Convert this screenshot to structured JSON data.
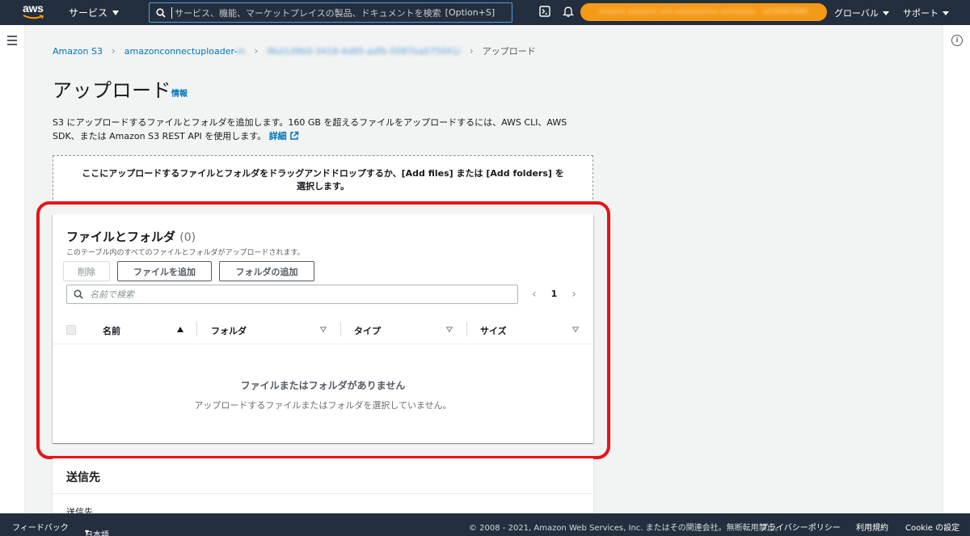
{
  "topnav": {
    "logo_text": "aws",
    "services_label": "サービス",
    "search_placeholder": "サービス、機能、マーケットプレイスの製品、ドキュメントを検索",
    "search_shortcut": "[Option+S]",
    "account_blurred": "xxxxxx xxxxxxx xxx xxxxxxxxxx xxxxxxxx · 1234567890",
    "region_label": "グローバル",
    "support_label": "サポート"
  },
  "breadcrumb": {
    "items": [
      "Amazon S3",
      "amazonconnectuploader-",
      "9bd1d9b0-3418-4d85-adfb-5087ba075041/",
      "アップロード"
    ],
    "bucket_suffix_blurred": "in"
  },
  "page": {
    "title": "アップロード",
    "info_link": "情報",
    "description": "S3 にアップロードするファイルとフォルダを追加します。160 GB を超えるファイルをアップロードするには、AWS CLI、AWS SDK、または Amazon S3 REST API を使用します。",
    "learn_more": "詳細"
  },
  "dropzone": {
    "text": "ここにアップロードするファイルとフォルダをドラッグアンドドロップするか、[Add files] または [Add folders] を選択します。"
  },
  "files_panel": {
    "title": "ファイルとフォルダ",
    "count": "(0)",
    "subtitle": "このテーブル内のすべてのファイルとフォルダがアップロードされます。",
    "buttons": {
      "delete": "削除",
      "add_files": "ファイルを追加",
      "add_folder": "フォルダの追加"
    },
    "filter_placeholder": "名前で検索",
    "page_number": "1",
    "columns": [
      "名前",
      "フォルダ",
      "タイプ",
      "サイズ"
    ],
    "empty_title": "ファイルまたはフォルダがありません",
    "empty_subtitle": "アップロードするファイルまたはフォルダを選択していません。"
  },
  "destination": {
    "title": "送信先",
    "field_label": "送信先"
  },
  "footer": {
    "feedback": "フィードバック",
    "language": "日本語",
    "copyright": "© 2008 - 2021, Amazon Web Services, Inc. またはその関連会社。無断転用禁止。",
    "privacy": "プライバシーポリシー",
    "terms": "利用規約",
    "cookies": "Cookie の設定"
  },
  "colors": {
    "nav_bg": "#232f3e",
    "link": "#0073bb",
    "account_pill": "#f59a16",
    "highlight": "#e8141b",
    "search_border": "#539fe5"
  },
  "icons": [
    "hamburger-icon",
    "search-icon",
    "cloudshell-icon",
    "bell-icon",
    "info-icon",
    "external-link-icon",
    "chevron-left-icon",
    "chevron-right-icon",
    "sort-ascending-icon",
    "sort-descending-icon"
  ]
}
